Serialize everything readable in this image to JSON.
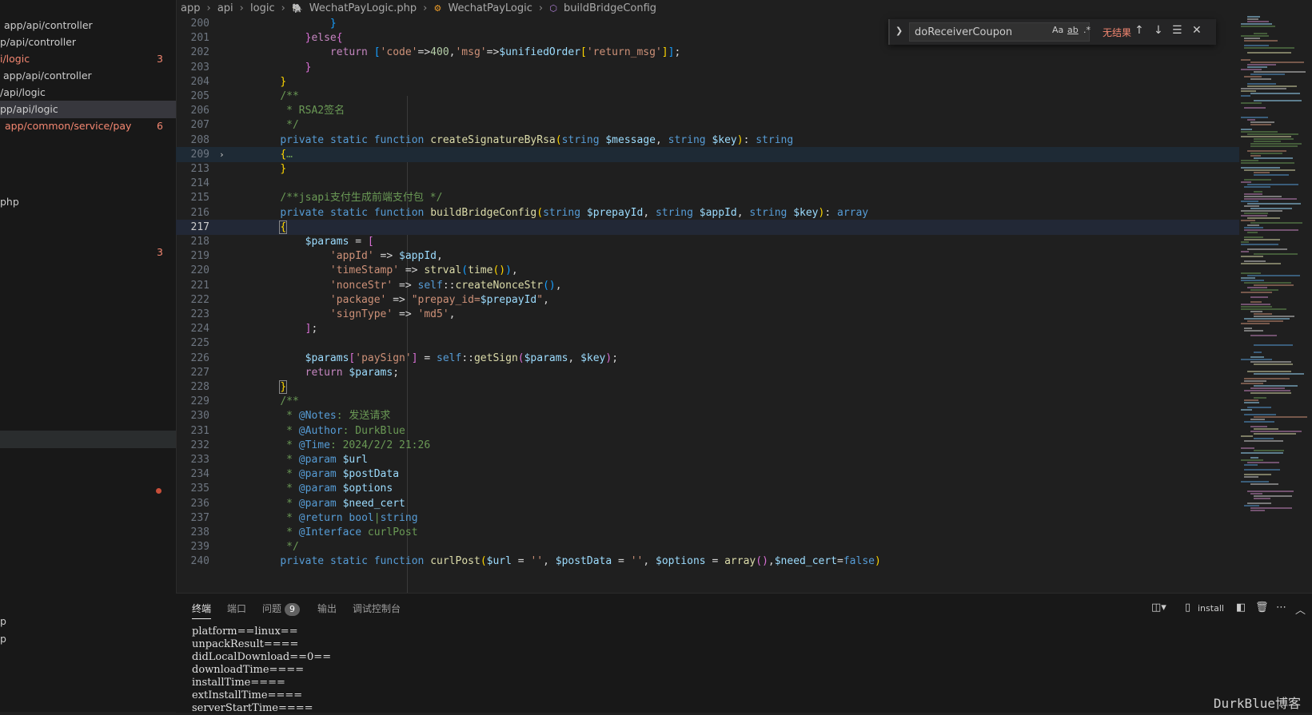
{
  "sidebar": {
    "rows": [
      {
        "text": "app/api/controller",
        "badge": "",
        "state": "plain",
        "indent": 5
      },
      {
        "text": "p/api/controller",
        "badge": "",
        "state": "plain",
        "indent": 0
      },
      {
        "text": "i/logic",
        "badge": "3",
        "state": "err",
        "indent": 0
      },
      {
        "text": "app/api/controller",
        "badge": "",
        "state": "plain",
        "indent": 4
      },
      {
        "text": "/api/logic",
        "badge": "",
        "state": "plain",
        "indent": 0
      },
      {
        "text": "pp/api/logic",
        "badge": "",
        "state": "sel",
        "indent": 0
      },
      {
        "text": "app/common/service/pay",
        "badge": "6",
        "state": "err",
        "indent": 6
      },
      {
        "text": "php",
        "badge": "",
        "state": "plain",
        "indent": 0
      },
      {
        "text": "",
        "badge": "3",
        "state": "err",
        "indent": 0
      },
      {
        "text": "p",
        "badge": "",
        "state": "plain",
        "indent": 0
      },
      {
        "text": "p",
        "badge": "",
        "state": "plain",
        "indent": 0
      }
    ]
  },
  "breadcrumb": {
    "items": [
      "app",
      "api",
      "logic",
      "WechatPayLogic.php",
      "WechatPayLogic",
      "buildBridgeConfig"
    ]
  },
  "find": {
    "query": "doReceiverCoupon",
    "match_case": "Aa",
    "whole_word": "ab",
    "regex": ".*",
    "result": "无结果"
  },
  "editor": {
    "current_line": "217",
    "lines": [
      {
        "n": "200",
        "html": "            <span class='br3'>}</span>"
      },
      {
        "n": "201",
        "html": "        <span class='br2'>}</span><span class='kw'>else</span><span class='br2'>{</span>"
      },
      {
        "n": "202",
        "html": "            <span class='kw'>return</span> <span class='br3'>[</span><span class='s'>'code'</span>=><span class='n'>400</span>,<span class='s'>'msg'</span>=><span class='v'>$unifiedOrder</span><span class='br1'>[</span><span class='s'>'return_msg'</span><span class='br1'>]</span><span class='br3'>]</span>;"
      },
      {
        "n": "203",
        "html": "        <span class='br2'>}</span>"
      },
      {
        "n": "204",
        "html": "    <span class='br1'>}</span>"
      },
      {
        "n": "205",
        "html": "    <span class='c'>/**</span>"
      },
      {
        "n": "206",
        "html": "<span class='c'>     * RSA2签名</span>"
      },
      {
        "n": "207",
        "html": "<span class='c'>     */</span>"
      },
      {
        "n": "208",
        "html": "    <span class='k'>private</span> <span class='k'>static</span> <span class='k'>function</span> <span class='f'>createSignatureByRsa</span><span class='br1'>(</span><span class='k'>string</span> <span class='v'>$message</span>, <span class='k'>string</span> <span class='v'>$key</span><span class='br1'>)</span>: <span class='k'>string</span>"
      },
      {
        "n": "209",
        "html": "    <span class='br1'>{</span><span class='c'>…</span>"
      },
      {
        "n": "213",
        "html": "    <span class='br1'>}</span>"
      },
      {
        "n": "214",
        "html": ""
      },
      {
        "n": "215",
        "html": "    <span class='c'>/**jsapi支付生成前端支付包 */</span>"
      },
      {
        "n": "216",
        "html": "    <span class='k'>private</span> <span class='k'>static</span> <span class='k'>function</span> <span class='f'>buildBridgeConfig</span><span class='br1'>(</span><span class='k'>string</span> <span class='v'>$prepayId</span>, <span class='k'>string</span> <span class='v'>$appId</span>, <span class='k'>string</span> <span class='v'>$key</span><span class='br1'>)</span>: <span class='k'>array</span>"
      },
      {
        "n": "217",
        "html": "    <span class='br1 bracket-box'>{</span>"
      },
      {
        "n": "218",
        "html": "        <span class='v'>$params</span> = <span class='br2'>[</span>"
      },
      {
        "n": "219",
        "html": "            <span class='s'>'appId'</span> => <span class='v'>$appId</span>,"
      },
      {
        "n": "220",
        "html": "            <span class='s'>'timeStamp'</span> => <span class='f'>strval</span><span class='br3'>(</span><span class='f'>time</span><span class='br1'>()</span><span class='br3'>)</span>,"
      },
      {
        "n": "221",
        "html": "            <span class='s'>'nonceStr'</span> => <span class='k'>self</span>::<span class='f'>createNonceStr</span><span class='br3'>()</span>,"
      },
      {
        "n": "222",
        "html": "            <span class='s'>'package'</span> => <span class='s'>\"prepay_id=</span><span class='v'>$prepayId</span><span class='s'>\"</span>,"
      },
      {
        "n": "223",
        "html": "            <span class='s'>'signType'</span> => <span class='s'>'md5'</span>,"
      },
      {
        "n": "224",
        "html": "        <span class='br2'>]</span>;"
      },
      {
        "n": "225",
        "html": ""
      },
      {
        "n": "226",
        "html": "        <span class='v'>$params</span><span class='br2'>[</span><span class='s'>'paySign'</span><span class='br2'>]</span> = <span class='k'>self</span>::<span class='f'>getSign</span><span class='br2'>(</span><span class='v'>$params</span>, <span class='v'>$key</span><span class='br2'>)</span>;"
      },
      {
        "n": "227",
        "html": "        <span class='kw'>return</span> <span class='v'>$params</span>;"
      },
      {
        "n": "228",
        "html": "    <span class='br1 bracket-box'>}</span>"
      },
      {
        "n": "229",
        "html": "    <span class='c'>/**</span>"
      },
      {
        "n": "230",
        "html": "<span class='c'>     * </span><span class='ct'>@Notes</span><span class='c'>: 发送请求</span>"
      },
      {
        "n": "231",
        "html": "<span class='c'>     * </span><span class='ct'>@Author</span><span class='c'>: DurkBlue</span>"
      },
      {
        "n": "232",
        "html": "<span class='c'>     * </span><span class='ct'>@Time</span><span class='c'>: 2024/2/2 21:26</span>"
      },
      {
        "n": "233",
        "html": "<span class='c'>     * </span><span class='ct'>@param</span> <span class='v'>$url</span>"
      },
      {
        "n": "234",
        "html": "<span class='c'>     * </span><span class='ct'>@param</span> <span class='v'>$postData</span>"
      },
      {
        "n": "235",
        "html": "<span class='c'>     * </span><span class='ct'>@param</span> <span class='v'>$options</span>"
      },
      {
        "n": "236",
        "html": "<span class='c'>     * </span><span class='ct'>@param</span> <span class='v'>$need_cert</span>"
      },
      {
        "n": "237",
        "html": "<span class='c'>     * </span><span class='ct'>@return</span> <span class='k'>bool</span><span class='c'>|</span><span class='k'>string</span>"
      },
      {
        "n": "238",
        "html": "<span class='c'>     * </span><span class='ct'>@Interface</span><span class='c'> curlPost</span>"
      },
      {
        "n": "239",
        "html": "<span class='c'>     */</span>"
      },
      {
        "n": "240",
        "html": "    <span class='k'>private</span> <span class='k'>static</span> <span class='k'>function</span> <span class='f'>curlPost</span><span class='br1'>(</span><span class='v'>$url</span> = <span class='s'>''</span>, <span class='v'>$postData</span> = <span class='s'>''</span>, <span class='v'>$options</span> = <span class='f'>array</span><span class='br2'>()</span>,<span class='v'>$need_cert</span>=<span class='k'>false</span><span class='br1'>)</span>"
      }
    ]
  },
  "panel": {
    "tabs": [
      {
        "label": "终端",
        "active": true
      },
      {
        "label": "端口",
        "active": false
      },
      {
        "label": "问题",
        "active": false,
        "badge": "9"
      },
      {
        "label": "输出",
        "active": false
      },
      {
        "label": "调试控制台",
        "active": false
      }
    ],
    "terminal_name": "install",
    "terminal_lines": [
      "platform==linux==",
      "unpackResult====",
      "didLocalDownload==0==",
      "downloadTime====",
      "installTime====",
      "extInstallTime====",
      "serverStartTime===="
    ]
  },
  "watermark": "DurkBlue博客"
}
